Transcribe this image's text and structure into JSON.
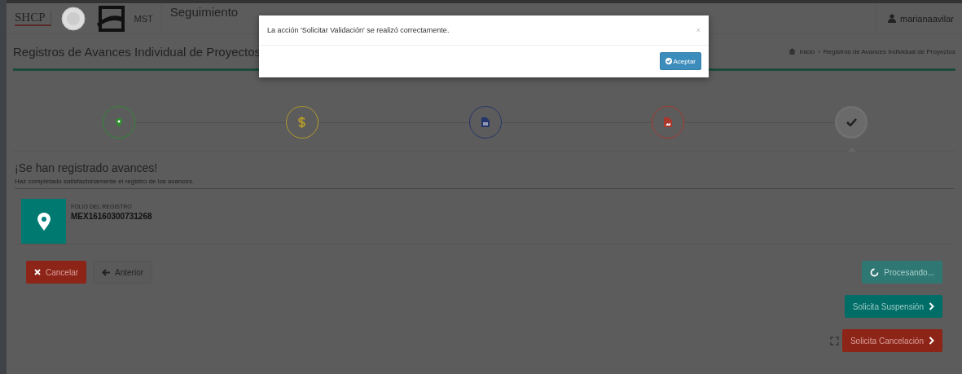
{
  "header": {
    "logo": "SHCP",
    "brand": "MST",
    "title": "Seguimiento",
    "user": "marianaavilar"
  },
  "page": {
    "title": "Registros de Avances Individual de Proyectos",
    "breadcrumb": [
      "Inicio",
      "Registros de Avances Individual de Proyectos"
    ],
    "separator": "›"
  },
  "steps": [
    {
      "kind": "pin",
      "color": "#2f8a2f",
      "selected": false
    },
    {
      "kind": "dollar",
      "color": "#b39a2c",
      "selected": false
    },
    {
      "kind": "file",
      "color": "#25356a",
      "selected": false
    },
    {
      "kind": "image",
      "color": "#a8382e",
      "selected": false
    },
    {
      "kind": "check",
      "color": "#707070",
      "selected": true
    }
  ],
  "result": {
    "heading": "¡Se han registrado avances!",
    "message": "Haz completado satisfactoriamente el registro de los avances.",
    "folio_label": "FOLIO DEL REGISTRO",
    "folio": "MEX16160300731268"
  },
  "left_buttons": [
    {
      "kind": "danger",
      "label": "Cancelar"
    },
    {
      "kind": "back",
      "label": "Anterior"
    }
  ],
  "right_buttons": [
    {
      "kind": "processing",
      "label": "Procesando...",
      "disabled": true
    },
    {
      "kind": "teal",
      "label": "Solicita Suspensión",
      "disabled": false
    },
    {
      "kind": "danger",
      "label": "Solicita Cancelación",
      "disabled": false
    }
  ],
  "modal": {
    "message": "La acción 'Solicitar Validación' se realizó correctamente.",
    "close": "×",
    "accept": "Aceptar"
  }
}
